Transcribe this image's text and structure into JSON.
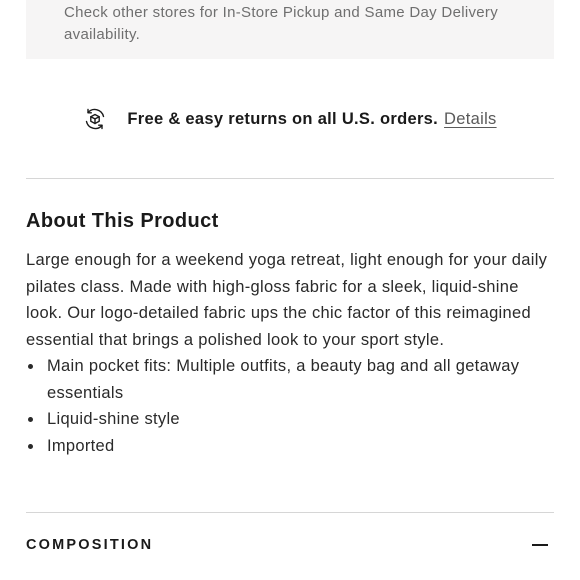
{
  "pickup": {
    "text": "Check other stores for In-Store Pickup and Same Day Delivery availability."
  },
  "returns": {
    "text": "Free & easy returns on all U.S. orders.",
    "link_label": "Details",
    "icon": "returns-box-icon"
  },
  "about": {
    "title": "About This Product",
    "description": "Large enough for a weekend yoga retreat, light enough for your daily pilates class. Made with high-gloss fabric for a sleek, liquid-shine look. Our logo-detailed fabric ups the chic factor of this reimagined essential that brings a polished look to your sport style.",
    "bullets": [
      "Main pocket fits: Multiple outfits, a beauty bag and all getaway essentials",
      "Liquid-shine style",
      "Imported"
    ]
  },
  "composition": {
    "label": "COMPOSITION",
    "icon": "minus-icon"
  },
  "colors": {
    "box_bg": "#f6f5f5",
    "divider": "#d6d6d6",
    "text": "#1a1a1a",
    "muted": "#6f6f6f"
  }
}
